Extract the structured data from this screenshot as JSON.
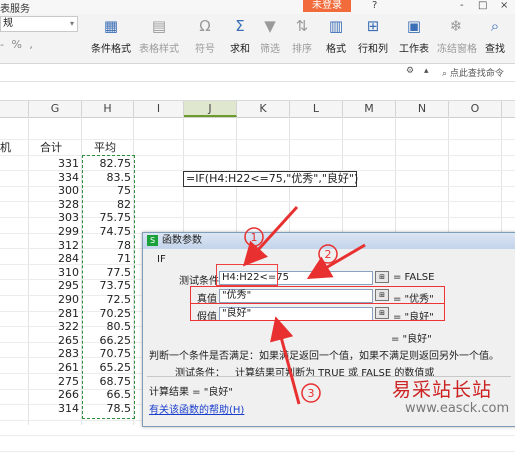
{
  "titlebar": {
    "title_fragment": "表服务",
    "unregistered": "未登录",
    "window_controls": [
      "?",
      "-",
      "□",
      "×"
    ]
  },
  "ribbon": {
    "style_combo": "规",
    "format_row": "- % ,",
    "buttons": [
      {
        "label": "条件格式",
        "icon": "conditional-format-icon",
        "dim": false
      },
      {
        "label": "表格样式",
        "icon": "table-style-icon",
        "dim": true
      },
      {
        "label": "符号",
        "icon": "omega-icon",
        "dim": true
      },
      {
        "label": "求和",
        "icon": "sigma-icon",
        "dim": false
      },
      {
        "label": "筛选",
        "icon": "filter-icon",
        "dim": true
      },
      {
        "label": "排序",
        "icon": "sort-icon",
        "dim": true
      },
      {
        "label": "格式",
        "icon": "format-icon",
        "dim": false
      },
      {
        "label": "行和列",
        "icon": "rows-columns-icon",
        "dim": false
      },
      {
        "label": "工作表",
        "icon": "worksheet-icon",
        "dim": false
      },
      {
        "label": "冻结窗格",
        "icon": "freeze-icon",
        "dim": true
      },
      {
        "label": "查找",
        "icon": "search-icon",
        "dim": false
      }
    ],
    "help_search": "点此查找命令"
  },
  "grid": {
    "columns": [
      "G",
      "H",
      "I",
      "J",
      "K",
      "L",
      "M",
      "N",
      "O"
    ],
    "selected_column": "J",
    "headers": {
      "left_fragment": "机",
      "g": "合计",
      "h": "平均"
    },
    "rows": [
      {
        "total": "331",
        "avg": "82.75"
      },
      {
        "total": "334",
        "avg": "83.5"
      },
      {
        "total": "300",
        "avg": "75"
      },
      {
        "total": "328",
        "avg": "82"
      },
      {
        "total": "303",
        "avg": "75.75"
      },
      {
        "total": "299",
        "avg": "74.75"
      },
      {
        "total": "312",
        "avg": "78"
      },
      {
        "total": "284",
        "avg": "71"
      },
      {
        "total": "310",
        "avg": "77.5"
      },
      {
        "total": "295",
        "avg": "73.75"
      },
      {
        "total": "290",
        "avg": "72.5"
      },
      {
        "total": "281",
        "avg": "70.25"
      },
      {
        "total": "322",
        "avg": "80.5"
      },
      {
        "total": "265",
        "avg": "66.25"
      },
      {
        "total": "283",
        "avg": "70.75"
      },
      {
        "total": "261",
        "avg": "65.25"
      },
      {
        "total": "275",
        "avg": "68.75"
      },
      {
        "total": "266",
        "avg": "66.5"
      },
      {
        "total": "314",
        "avg": "78.5"
      }
    ],
    "formula": "=IF(H4:H22<=75,\"优秀\",\"良好\")"
  },
  "dialog": {
    "title": "函数参数",
    "function_name": "IF",
    "fields": [
      {
        "label": "测试条件",
        "value": "H4:H22<=75",
        "result": "= FALSE"
      },
      {
        "label": "真值",
        "value": "\"优秀\"",
        "result": "= \"优秀\""
      },
      {
        "label": "假值",
        "value": "\"良好\"",
        "result": "= \"良好\""
      }
    ],
    "overall_result": "= \"良好\"",
    "description": "判断一个条件是否满足：如果满足返回一个值，如果不满足则返回另外一个值。",
    "param_help_label": "测试条件：",
    "param_help_text": "计算结果可判断为 TRUE 或 FALSE 的数值或",
    "calc_result": "计算结果 = \"良好\"",
    "help_link": "有关该函数的帮助(H)"
  },
  "annotations": {
    "markers": [
      "1",
      "2",
      "3"
    ],
    "color": "#e83030"
  },
  "watermark": {
    "text": "易采站长站",
    "url": "www.easck.com"
  }
}
